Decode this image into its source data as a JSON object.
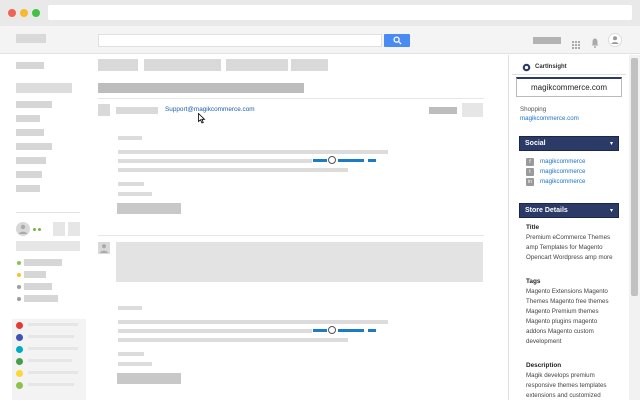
{
  "email": {
    "from_link": "Support@magikcommerce.com"
  },
  "panel": {
    "header_title": "CartInsight",
    "domain": "magikcommerce.com",
    "shopping_label": "Shopping",
    "shopping_link": "magikcommerce.com",
    "social": {
      "heading": "Social",
      "items": [
        {
          "icon": "facebook-icon",
          "label": "magikcommerce"
        },
        {
          "icon": "twitter-icon",
          "label": "magikcommerce"
        },
        {
          "icon": "linkedin-icon",
          "label": "magikcommerce"
        }
      ]
    },
    "store": {
      "heading": "Store Details",
      "title_label": "Title",
      "title_value": "Premium eCommerce Themes amp Templates for Magento Opencart Wordpress amp more",
      "tags_label": "Tags",
      "tags_value": "Magento Extensions Magento Themes Magento free themes Magento Premium themes Magento plugins magento addons Magento custom development",
      "description_label": "Description",
      "description_value": "Magik develops premium responsive themes templates extensions and customized"
    }
  },
  "colors": {
    "panel_header": "#2b3a67",
    "search_button": "#4a8af4",
    "link": "#1a73c7",
    "label_dots": [
      "#e53935",
      "#3f51b5",
      "#00acc1",
      "#43a047",
      "#fdd835",
      "#8bc34a"
    ]
  }
}
